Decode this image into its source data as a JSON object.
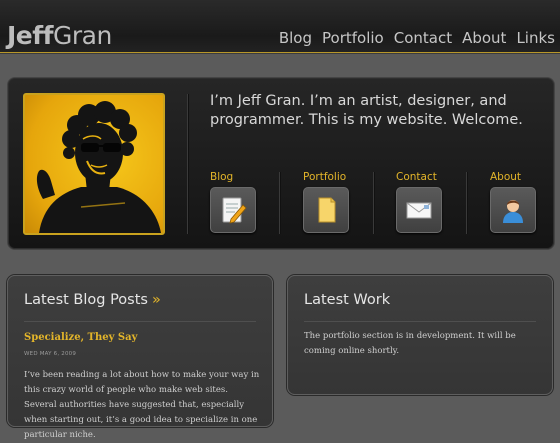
{
  "header": {
    "logo_first": "Jeff",
    "logo_last": "Gran",
    "nav": [
      "Blog",
      "Portfolio",
      "Contact",
      "About",
      "Links"
    ]
  },
  "hero": {
    "tagline": "I’m Jeff Gran. I’m an artist, designer, and programmer.  This is my website.  Welcome.",
    "links": [
      {
        "label": "Blog",
        "icon": "notepad-pencil-icon"
      },
      {
        "label": "Portfolio",
        "icon": "folder-icon"
      },
      {
        "label": "Contact",
        "icon": "envelope-icon"
      },
      {
        "label": "About",
        "icon": "user-icon"
      }
    ]
  },
  "blog": {
    "heading": "Latest Blog Posts",
    "heading_arrow": "»",
    "post_title": "Specialize, They Say",
    "post_date": "WED MAY 6, 2009",
    "post_excerpt": "I’ve been reading a lot about how to make your way in this crazy world of people who make web sites. Several authorities have suggested that, especially when starting out, it’s a good idea to specialize in one particular niche."
  },
  "work": {
    "heading": "Latest Work",
    "text": "The portfolio section is in development. It will be coming online shortly."
  },
  "colors": {
    "accent": "#e3b52a",
    "background": "#5b5b5b",
    "header": "#1e1e1e"
  }
}
